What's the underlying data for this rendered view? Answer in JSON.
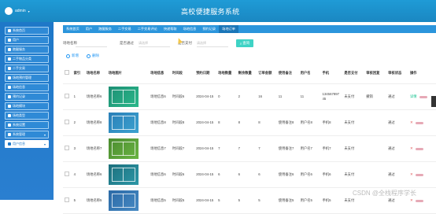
{
  "header": {
    "user_name": "admin",
    "title": "高校便捷服务系统"
  },
  "sidebar": {
    "items": [
      {
        "label": "系统首页",
        "icon": "home-icon"
      },
      {
        "label": "用户",
        "icon": "user-icon"
      },
      {
        "label": "跑腿服务",
        "icon": "grid-icon"
      },
      {
        "label": "二手物品分类",
        "icon": "category-icon"
      },
      {
        "label": "二手交易",
        "icon": "trade-icon"
      },
      {
        "label": "场地预约管理",
        "icon": "calendar-icon"
      },
      {
        "label": "场地信息",
        "icon": "info-icon"
      },
      {
        "label": "预约记录",
        "icon": "record-icon"
      },
      {
        "label": "场地模块",
        "icon": "module-icon"
      },
      {
        "label": "场地类型",
        "icon": "type-icon"
      },
      {
        "label": "系统设置",
        "icon": "settings-icon"
      },
      {
        "label": "系统管理",
        "icon": "manage-icon"
      },
      {
        "label": "用户信息",
        "icon": "profile-icon"
      }
    ]
  },
  "nav": {
    "items": [
      "系统首页",
      "用户",
      "跑腿服务",
      "二手交易",
      "二手交易评论",
      "快递帮取",
      "场地信息",
      "预约记录",
      "场地订单"
    ]
  },
  "search": {
    "field1_label": "场地名称",
    "field2_label": "是否通过",
    "field2_placeholder": "请选择",
    "field3_label": "是否支付",
    "field3_placeholder": "请选择",
    "button_label": "查询"
  },
  "actions": {
    "add_label": "新增",
    "delete_label": "删除"
  },
  "table": {
    "columns": [
      "索引",
      "场地名称",
      "场地图片",
      "场地信息",
      "时间段",
      "预约日期",
      "场地数量",
      "剩余数量",
      "订单金额",
      "使用备注",
      "用户名",
      "手机",
      "是否支付",
      "审核回复",
      "审核状态",
      "操作"
    ],
    "rows": [
      {
        "idx": "1",
        "name": "场地名称6",
        "info": "场地信息6",
        "slot": "时间段6",
        "date": "2024-04-15",
        "qty": "0",
        "left": "2",
        "amount": "16",
        "note": "11",
        "user": "11",
        "phone": "13456789745",
        "paid": "未支付",
        "reply": "撤销",
        "status": "通过"
      },
      {
        "idx": "2",
        "name": "场地名称8",
        "info": "场地信息8",
        "slot": "时间段8",
        "date": "2024-04-15",
        "qty": "8",
        "left": "8",
        "amount": "8",
        "note": "使用备注8",
        "user": "用户名8",
        "phone": "手机8",
        "paid": "未支付",
        "reply": "",
        "status": "通过"
      },
      {
        "idx": "3",
        "name": "场地名称7",
        "info": "场地信息7",
        "slot": "时间段7",
        "date": "2024-04-15",
        "qty": "7",
        "left": "7",
        "amount": "7",
        "note": "使用备注7",
        "user": "用户名7",
        "phone": "手机7",
        "paid": "未支付",
        "reply": "",
        "status": "通过"
      },
      {
        "idx": "4",
        "name": "场地名称6",
        "info": "场地信息6",
        "slot": "时间段6",
        "date": "2024-04-15",
        "qty": "6",
        "left": "6",
        "amount": "6",
        "note": "使用备注6",
        "user": "用户名6",
        "phone": "手机6",
        "paid": "未支付",
        "reply": "",
        "status": "通过"
      },
      {
        "idx": "5",
        "name": "场地名称5",
        "info": "场地信息5",
        "slot": "时间段5",
        "date": "2024-04-15",
        "qty": "5",
        "left": "5",
        "amount": "5",
        "note": "使用备注5",
        "user": "用户名5",
        "phone": "手机5",
        "paid": "未支付",
        "reply": "",
        "status": "通过"
      }
    ],
    "detail_label": "详情",
    "delete_label": "删除"
  },
  "watermark": "CSDN @全栈程序学长",
  "colors": {
    "header": "#1f9bd6",
    "sidebar": "#1e78c8",
    "accent": "#3fd3c5",
    "status_green": "#13c28f"
  }
}
